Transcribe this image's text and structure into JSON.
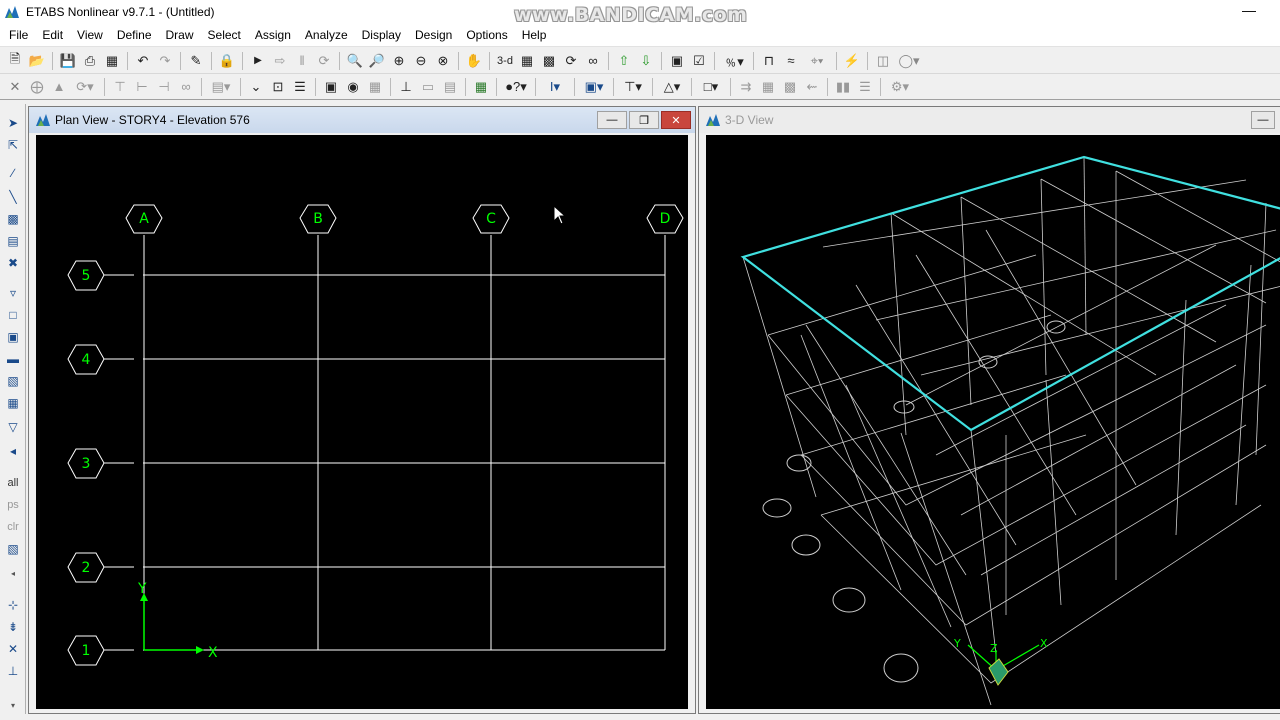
{
  "app": {
    "title": "ETABS Nonlinear v9.7.1 - (Untitled)",
    "watermark": "www.BANDICAM.com"
  },
  "menu": [
    "File",
    "Edit",
    "View",
    "Define",
    "Draw",
    "Select",
    "Assign",
    "Analyze",
    "Display",
    "Design",
    "Options",
    "Help"
  ],
  "toolbar": {
    "view_3d_label": "3-d"
  },
  "plan_view": {
    "title": "Plan View - STORY4 - Elevation 576",
    "grid_columns": [
      "A",
      "B",
      "C",
      "D"
    ],
    "grid_rows": [
      "5",
      "4",
      "3",
      "2",
      "1"
    ],
    "axis_x": "X",
    "axis_y": "Y",
    "colors": {
      "grid": "#ffffff",
      "bubble": "#00ff00",
      "axes": "#00ff00",
      "background": "#000000"
    }
  },
  "view_3d": {
    "title": "3-D View",
    "axis_x": "X",
    "axis_y": "Y",
    "axis_z": "Z",
    "colors": {
      "frame": "#cfcfcf",
      "highlight": "#40e0e0",
      "background": "#000000"
    }
  },
  "left_toolbar": {
    "all_label": "all",
    "ps_label": "ps",
    "clr_label": "clr"
  }
}
